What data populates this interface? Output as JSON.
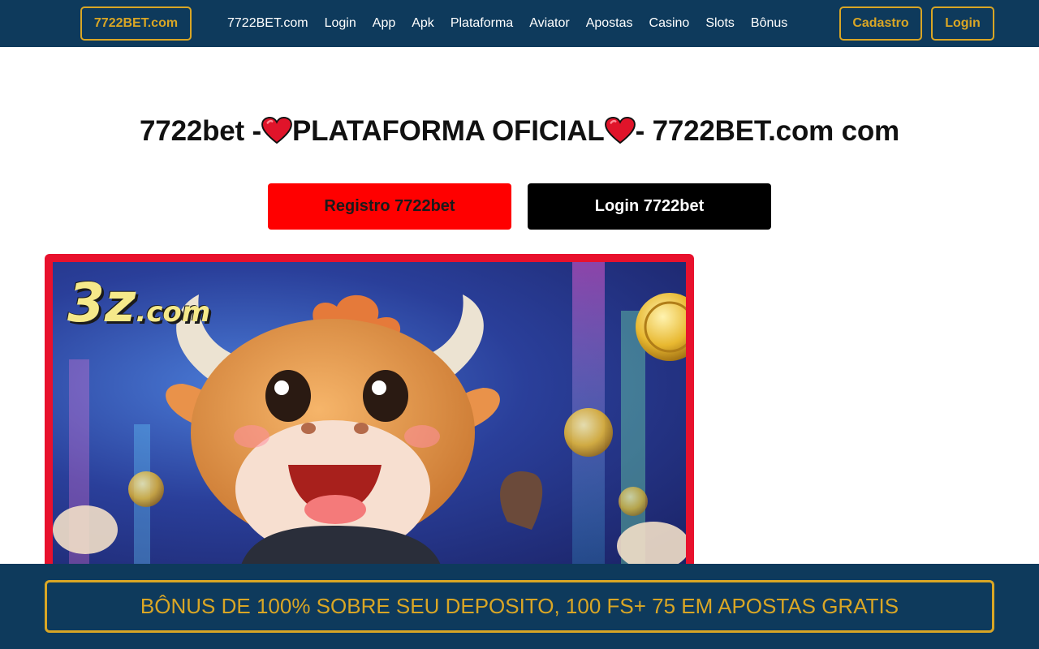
{
  "header": {
    "brand_label": "7722BET.com",
    "nav_items": [
      "7722BET.com",
      "Login",
      "App",
      "Apk",
      "Plataforma",
      "Aviator",
      "Apostas",
      "Casino",
      "Slots",
      "Bônus"
    ],
    "cadastro_label": "Cadastro",
    "login_label": "Login"
  },
  "headline": {
    "prefix": "7722bet -",
    "middle": "PLATAFORMA OFICIAL",
    "suffix": "- 7722BET.com com",
    "icon": "heart-icon"
  },
  "cta": {
    "register_label": "Registro 7722bet",
    "login_label": "Login 7722bet"
  },
  "banner": {
    "logo_big": "3z",
    "logo_small": ".com"
  },
  "promo": {
    "text": "BÔNUS DE 100% SOBRE SEU DEPOSITO, 100 FS+ 75 EM APOSTAS GRATIS"
  },
  "colors": {
    "header_bg": "#0e3a5c",
    "accent_gold": "#d9a625",
    "register_red": "#ff0000",
    "banner_frame": "#e8112d"
  }
}
